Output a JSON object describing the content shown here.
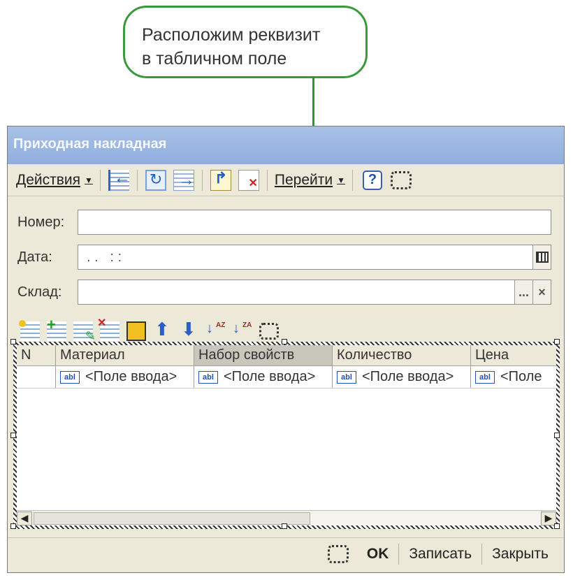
{
  "callout": {
    "line1": "Расположим реквизит",
    "line2": "в табличном поле"
  },
  "window": {
    "title": "Приходная накладная"
  },
  "toolbar": {
    "actions_label": "Действия",
    "goto_label": "Перейти",
    "icons": [
      "list-back-icon",
      "refresh-icon",
      "goto-icon",
      "post-doc-icon",
      "delete-doc-icon",
      "help-icon",
      "frame-icon"
    ]
  },
  "fields": {
    "number": {
      "label": "Номер:",
      "value": ""
    },
    "date": {
      "label": "Дата:",
      "value": ". .   : :"
    },
    "warehouse": {
      "label": "Склад:",
      "value": "",
      "select_button": "...",
      "clear_button": "×"
    }
  },
  "table_toolbar": {
    "icons": [
      "add-icon",
      "add-row-icon",
      "edit-icon",
      "delete-icon",
      "save-icon",
      "move-up-icon",
      "move-down-icon",
      "sort-asc-icon",
      "sort-desc-icon",
      "frame-icon"
    ],
    "sort_asc_text": "AZ",
    "sort_desc_text": "ZA"
  },
  "table": {
    "columns": [
      "N",
      "Материал",
      "Набор свойств",
      "Количество",
      "Цена"
    ],
    "row": [
      "",
      "<Поле ввода>",
      "<Поле ввода>",
      "<Поле ввода>",
      "<Поле"
    ],
    "field_badge": "abl"
  },
  "bottom": {
    "ok_label": "OK",
    "save_label": "Записать",
    "close_label": "Закрыть"
  },
  "colors": {
    "callout_border": "#3a9a3a",
    "titlebar": "#90aedd",
    "window_bg": "#ece9d8"
  }
}
